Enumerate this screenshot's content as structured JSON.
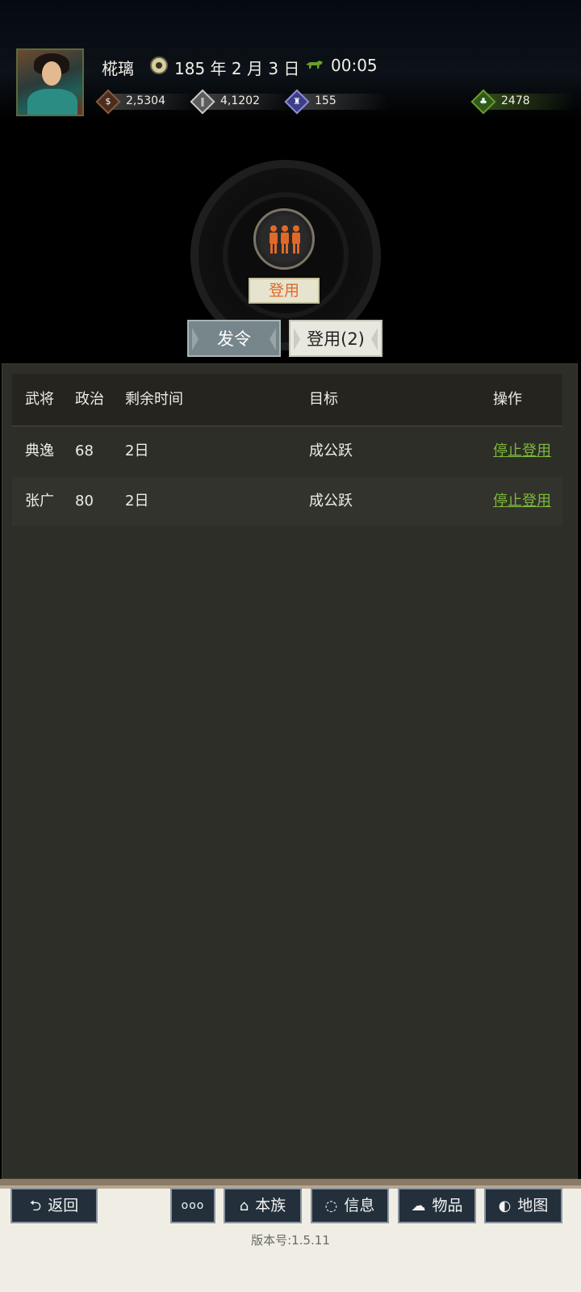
{
  "header": {
    "player_name": "椛璃",
    "date": "185 年 2 月 3 日",
    "time": "00:05",
    "stats": [
      {
        "icon": "coin-icon",
        "value": "2,5304"
      },
      {
        "icon": "grain-icon",
        "value": "4,1202"
      },
      {
        "icon": "troops-icon",
        "value": "155"
      },
      {
        "icon": "pouch-icon",
        "value": "2478"
      }
    ]
  },
  "feature": {
    "icon": "people-icon",
    "label": "登用"
  },
  "tabs": [
    {
      "label": "发令"
    },
    {
      "label": "登用(2)"
    }
  ],
  "table": {
    "headers": [
      "武将",
      "政治",
      "剩余时间",
      "目标",
      "操作"
    ],
    "rows": [
      {
        "general": "典逸",
        "politics": "68",
        "remaining": "2日",
        "target": "成公跃",
        "action": "停止登用"
      },
      {
        "general": "张广",
        "politics": "80",
        "remaining": "2日",
        "target": "成公跃",
        "action": "停止登用"
      }
    ]
  },
  "nav": {
    "back": "返回",
    "more": "ooo",
    "clan": "本族",
    "info": "信息",
    "items": "物品",
    "map": "地图"
  },
  "version": "版本号:1.5.11",
  "colors": {
    "accent_orange": "#e0692a",
    "link_green": "#7cb83a",
    "panel_bg": "#2e2e29"
  }
}
